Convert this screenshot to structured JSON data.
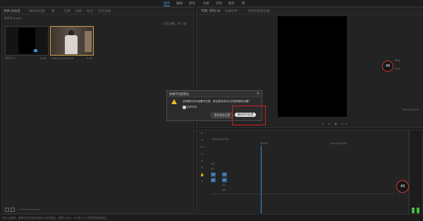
{
  "workspace_tabs": [
    "组件",
    "编辑",
    "颜色",
    "效果",
    "音频",
    "图形",
    "库"
  ],
  "project_panel": {
    "tabs": [
      "项目:未命名",
      "媒体浏览器",
      "库",
      "信息",
      "效果",
      "标记",
      "历史记录"
    ],
    "project_file": "未命名.prproj",
    "selection_info": "1 项已选择，共 2 项",
    "items": [
      {
        "name": "序列 01",
        "duration": "0:00"
      },
      {
        "name": "Video_20XX.mp4",
        "duration": "0:03"
      }
    ]
  },
  "program_monitor": {
    "tabs": [
      "节目: 序列 01",
      "效果控件",
      "音频剪辑混合器"
    ],
    "timecode": "00:00:00:00",
    "fit_label": "适合",
    "right_timecode": "00:00:00:23"
  },
  "timeline": {
    "timecode": "00:00:00:00",
    "video_tracks": [
      "V3",
      "V2",
      "V1"
    ],
    "audio_tracks": [
      "A1",
      "A2",
      "A3"
    ],
    "ruler_marks": [
      "00:00",
      "00:00:05:00"
    ]
  },
  "dialog": {
    "title": "剪辑不匹配警告",
    "message": "此剪辑与序列设置不匹配。是否更改序列以匹配剪辑的设置？",
    "checkbox_label": "始终询问",
    "keep_button": "保持现有设置",
    "change_button": "更改序列设置"
  },
  "gauges": [
    {
      "value": "48",
      "unit": "%"
    },
    {
      "value": "48",
      "unit": "%"
    }
  ],
  "net_stats": [
    "0K/s",
    "0K/s"
  ],
  "status_bar": "单击以选择，或单击空白处并拖动以进行框选。使用 Shift、Alt 和 Ctrl 可获得其他选项。",
  "colors": {
    "accent": "#3d8fe0",
    "highlight_box": "#d42020",
    "track_blue": "#2f5f96",
    "meter_green": "#3fbf3f"
  }
}
